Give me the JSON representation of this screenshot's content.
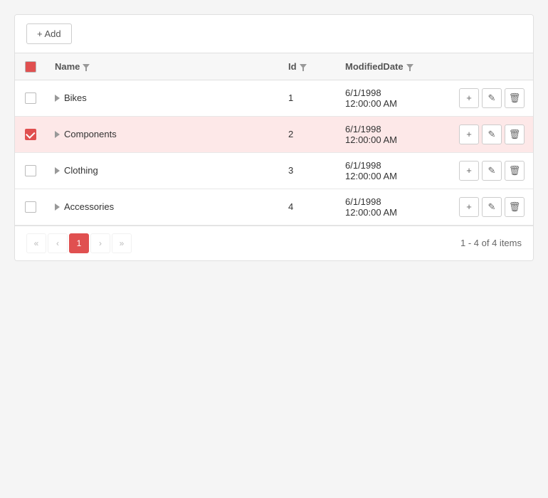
{
  "toolbar": {
    "add_label": "+ Add"
  },
  "table": {
    "header_checkbox_color": "#e05050",
    "columns": [
      {
        "key": "checkbox",
        "label": ""
      },
      {
        "key": "name",
        "label": "Name",
        "filterable": true
      },
      {
        "key": "id",
        "label": "Id",
        "filterable": true
      },
      {
        "key": "modified_date",
        "label": "ModifiedDate",
        "filterable": true
      },
      {
        "key": "actions",
        "label": ""
      }
    ],
    "rows": [
      {
        "id": 1,
        "name": "Bikes",
        "date": "6/1/1998\n12:00:00 AM",
        "selected": false
      },
      {
        "id": 2,
        "name": "Components",
        "date": "6/1/1998\n12:00:00 AM",
        "selected": true
      },
      {
        "id": 3,
        "name": "Clothing",
        "date": "6/1/1998\n12:00:00 AM",
        "selected": false
      },
      {
        "id": 4,
        "name": "Accessories",
        "date": "6/1/1998\n12:00:00 AM",
        "selected": false
      }
    ]
  },
  "pagination": {
    "current_page": 1,
    "total_pages": 1,
    "summary": "1 - 4 of 4 items"
  }
}
